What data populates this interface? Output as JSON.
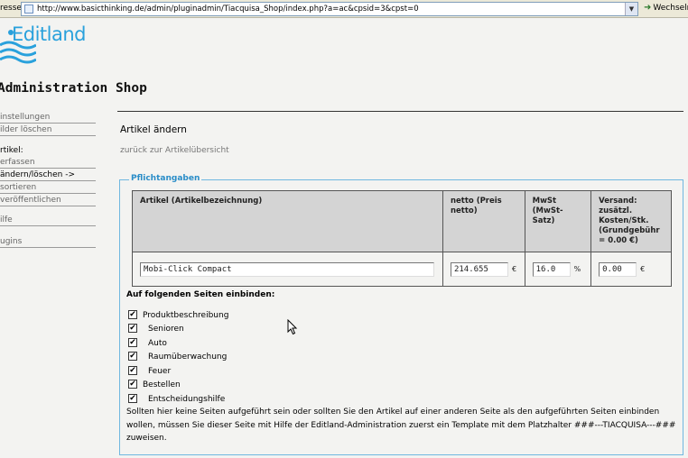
{
  "browser": {
    "address_label": "resse",
    "url": "http://www.basicthinking.de/admin/pluginadmin/Tiacquisa_Shop/index.php?a=ac&cpsid=3&cpst=0",
    "go_label": "Wechseln"
  },
  "logo": {
    "text": "Editland"
  },
  "site_title": "Administration Shop",
  "sidebar": {
    "items_top": [
      {
        "label": "instellungen"
      },
      {
        "label": "ilder löschen"
      }
    ],
    "artikel_heading": "rtikel:",
    "items_artikel": [
      {
        "label": "erfassen"
      },
      {
        "label": "ändern/löschen ->"
      },
      {
        "label": "sortieren"
      },
      {
        "label": "veröffentlichen"
      }
    ],
    "items_bottom": [
      {
        "label": "ilfe"
      },
      {
        "label": "ugins"
      }
    ]
  },
  "main": {
    "heading": "Artikel ändern",
    "back_link": "zurück zur Artikelübersicht",
    "legend": "Pflichtangaben",
    "table": {
      "headers": [
        "Artikel (Artikelbezeichnung)",
        "netto (Preis netto)",
        "MwSt (MwSt-Satz)",
        "Versand: zusätzl. Kosten/Stk. (Grundgebühr = 0.00 €)"
      ],
      "row": {
        "name": "Mobi-Click Compact",
        "netto": "214.655",
        "netto_unit": "€",
        "mwst": "16.0",
        "mwst_unit": "%",
        "versand": "0.00",
        "versand_unit": "€"
      }
    },
    "include_heading": "Auf folgenden Seiten einbinden:",
    "pages": [
      {
        "label": "Produktbeschreibung",
        "checked": "✔"
      },
      {
        "label": "Senioren",
        "checked": "✔"
      },
      {
        "label": "Auto",
        "checked": "✔"
      },
      {
        "label": "Raumüberwachung",
        "checked": "✔"
      },
      {
        "label": "Feuer",
        "checked": "✔"
      },
      {
        "label": "Bestellen",
        "checked": "✔"
      },
      {
        "label": "Entscheidungshilfe",
        "checked": "✔"
      }
    ],
    "note": "Sollten hier keine Seiten aufgeführt sein oder sollten Sie den Artikel auf einer anderen Seite als den aufgeführten Seiten einbinden wollen, müssen Sie dieser Seite mit Hilfe der Editland-Administration zuerst ein Template mit dem Platzhalter ###---TIACQUISA---### zuweisen."
  },
  "colors": {
    "accent": "#29a1dc",
    "fieldset_border": "#6fb7e0",
    "table_header": "#d4d4d4"
  }
}
